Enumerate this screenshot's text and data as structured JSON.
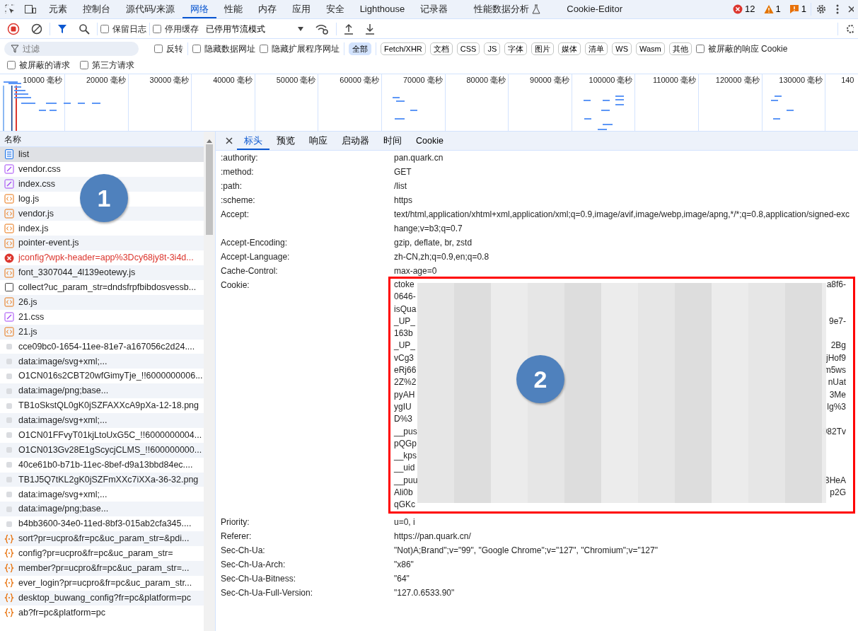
{
  "main_tabs": [
    {
      "label": "元素",
      "selected": false
    },
    {
      "label": "控制台",
      "selected": false
    },
    {
      "label": "源代码/来源",
      "selected": false
    },
    {
      "label": "网络",
      "selected": true
    },
    {
      "label": "性能",
      "selected": false
    },
    {
      "label": "内存",
      "selected": false
    },
    {
      "label": "应用",
      "selected": false
    },
    {
      "label": "安全",
      "selected": false
    },
    {
      "label": "Lighthouse",
      "selected": false
    },
    {
      "label": "记录器",
      "selected": false
    },
    {
      "label": "性能数据分析",
      "selected": false,
      "flask": true
    },
    {
      "label": "Cookie-Editor",
      "selected": false
    }
  ],
  "counts": [
    {
      "kind": "error",
      "text": "12"
    },
    {
      "kind": "warning",
      "text": "1"
    },
    {
      "kind": "issue",
      "text": "1"
    }
  ],
  "toolbar": {
    "checks": [
      {
        "label": "保留日志",
        "checked": false
      },
      {
        "label": "停用缓存",
        "checked": false
      }
    ],
    "throttle": "已停用节流模式"
  },
  "filter": {
    "placeholder": "过滤",
    "checks": [
      {
        "label": "反转",
        "checked": false
      },
      {
        "label": "隐藏数据网址",
        "checked": false
      },
      {
        "label": "隐藏扩展程序网址",
        "checked": false
      }
    ],
    "types": [
      {
        "label": "全部",
        "selected": true
      },
      {
        "label": "Fetch/XHR",
        "selected": false
      },
      {
        "label": "文档",
        "selected": false
      },
      {
        "label": "CSS",
        "selected": false
      },
      {
        "label": "JS",
        "selected": false
      },
      {
        "label": "字体",
        "selected": false
      },
      {
        "label": "图片",
        "selected": false
      },
      {
        "label": "媒体",
        "selected": false
      },
      {
        "label": "清单",
        "selected": false
      },
      {
        "label": "WS",
        "selected": false
      },
      {
        "label": "Wasm",
        "selected": false
      },
      {
        "label": "其他",
        "selected": false
      }
    ],
    "blocked_cookies": {
      "label": "被屏蔽的响应 Cookie",
      "checked": false
    },
    "row2": [
      {
        "label": "被屏蔽的请求",
        "checked": false
      },
      {
        "label": "第三方请求",
        "checked": false
      }
    ]
  },
  "timeline": {
    "ticks": [
      "10000 毫秒",
      "20000 毫秒",
      "30000 毫秒",
      "40000 毫秒",
      "50000 毫秒",
      "60000 毫秒",
      "70000 毫秒",
      "80000 毫秒",
      "90000 毫秒",
      "100000 毫秒",
      "110000 毫秒",
      "120000 毫秒",
      "130000 毫秒",
      "140"
    ]
  },
  "requests": {
    "column": "名称",
    "rows": [
      {
        "name": "list",
        "kind": "doc",
        "selected": true
      },
      {
        "name": "vendor.css",
        "kind": "css",
        "selected": false
      },
      {
        "name": "index.css",
        "kind": "css",
        "selected": false
      },
      {
        "name": "log.js",
        "kind": "js",
        "selected": false
      },
      {
        "name": "vendor.js",
        "kind": "js",
        "selected": false
      },
      {
        "name": "index.js",
        "kind": "js",
        "selected": false
      },
      {
        "name": "pointer-event.js",
        "kind": "js",
        "selected": false
      },
      {
        "name": "jconfig?wpk-header=app%3Dcy68jy8t-3i4d...",
        "kind": "error",
        "selected": false
      },
      {
        "name": "font_3307044_4l139eotewy.js",
        "kind": "js",
        "selected": false
      },
      {
        "name": "collect?uc_param_str=dndsfrpfbibdosvessb...",
        "kind": "other",
        "selected": false
      },
      {
        "name": "26.js",
        "kind": "js",
        "selected": false
      },
      {
        "name": "21.css",
        "kind": "css",
        "selected": false
      },
      {
        "name": "21.js",
        "kind": "js",
        "selected": false
      },
      {
        "name": "cce09bc0-1654-11ee-81e7-a167056c2d24....",
        "kind": "img",
        "selected": false
      },
      {
        "name": "data:image/svg+xml;...",
        "kind": "img",
        "selected": false
      },
      {
        "name": "O1CN016s2CBT20wfGimyTje_!!6000000006...",
        "kind": "img",
        "selected": false
      },
      {
        "name": "data:image/png;base...",
        "kind": "img",
        "selected": false
      },
      {
        "name": "TB1oSkstQL0gK0jSZFAXXcA9pXa-12-18.png",
        "kind": "img",
        "selected": false
      },
      {
        "name": "data:image/svg+xml;...",
        "kind": "img",
        "selected": false
      },
      {
        "name": "O1CN01FFvyT01kjLtoUxG5C_!!6000000004...",
        "kind": "img",
        "selected": false
      },
      {
        "name": "O1CN013Gv28E1gScycjCLMS_!!600000000...",
        "kind": "img",
        "selected": false
      },
      {
        "name": "40ce61b0-b71b-11ec-8bef-d9a13bbd84ec....",
        "kind": "img",
        "selected": false
      },
      {
        "name": "TB1J5Q7tKL2gK0jSZFmXXc7iXXa-36-32.png",
        "kind": "img",
        "selected": false
      },
      {
        "name": "data:image/svg+xml;...",
        "kind": "img",
        "selected": false
      },
      {
        "name": "data:image/png;base...",
        "kind": "img",
        "selected": false
      },
      {
        "name": "b4bb3600-34e0-11ed-8bf3-015ab2cfa345....",
        "kind": "img",
        "selected": false
      },
      {
        "name": "sort?pr=ucpro&fr=pc&uc_param_str=&pdi...",
        "kind": "fetch",
        "selected": false
      },
      {
        "name": "config?pr=ucpro&fr=pc&uc_param_str=",
        "kind": "fetch",
        "selected": false
      },
      {
        "name": "member?pr=ucpro&fr=pc&uc_param_str=...",
        "kind": "fetch",
        "selected": false
      },
      {
        "name": "ever_login?pr=ucpro&fr=pc&uc_param_str...",
        "kind": "fetch",
        "selected": false
      },
      {
        "name": "desktop_buwang_config?fr=pc&platform=pc",
        "kind": "fetch",
        "selected": false
      },
      {
        "name": "ab?fr=pc&platform=pc",
        "kind": "fetch",
        "selected": false
      }
    ]
  },
  "detail_tabs": [
    {
      "label": "标头",
      "selected": true
    },
    {
      "label": "预览",
      "selected": false
    },
    {
      "label": "响应",
      "selected": false
    },
    {
      "label": "启动器",
      "selected": false
    },
    {
      "label": "时间",
      "selected": false
    },
    {
      "label": "Cookie",
      "selected": false
    }
  ],
  "headers": [
    {
      "name": ":authority:",
      "value": "pan.quark.cn"
    },
    {
      "name": ":method:",
      "value": "GET"
    },
    {
      "name": ":path:",
      "value": "/list"
    },
    {
      "name": ":scheme:",
      "value": "https"
    },
    {
      "name": "Accept:",
      "value": "text/html,application/xhtml+xml,application/xml;q=0.9,image/avif,image/webp,image/apng,*/*;q=0.8,application/signed-exchange;v=b3;q=0.7"
    },
    {
      "name": "Accept-Encoding:",
      "value": "gzip, deflate, br, zstd"
    },
    {
      "name": "Accept-Language:",
      "value": "zh-CN,zh;q=0.9,en;q=0.8"
    },
    {
      "name": "Cache-Control:",
      "value": "max-age=0"
    },
    {
      "name": "Cookie:",
      "redacted_lines": [
        {
          "start": "ctoke",
          "end": "a8f6-"
        },
        {
          "start": "0646-"
        },
        {
          "start": "isQua"
        },
        {
          "start": "_UP_",
          "end": "9e7-"
        },
        {
          "start": "163b"
        },
        {
          "start": "_UP_",
          "end": "2Bg"
        },
        {
          "start": "vCg3",
          "end": "jHof9"
        },
        {
          "start": "eRj66",
          "end": "m5ws"
        },
        {
          "start": "2Z%2",
          "end": "nUat"
        },
        {
          "start": "pyAH",
          "end": "3Me"
        },
        {
          "start": "ygIU",
          "end": "lg%3"
        },
        {
          "start": "D%3"
        },
        {
          "start": "__pus",
          "end": "982Tv"
        },
        {
          "start": "pQGp"
        },
        {
          "start": "__kps"
        },
        {
          "start": "__uid"
        },
        {
          "start": "__puu",
          "end": "BHeA"
        },
        {
          "start": "Ali0b",
          "end": "p2G"
        },
        {
          "start": "qGKc"
        }
      ]
    },
    {
      "name": "Priority:",
      "value": "u=0, i"
    },
    {
      "name": "Referer:",
      "value": "https://pan.quark.cn/"
    },
    {
      "name": "Sec-Ch-Ua:",
      "value": "\"Not)A;Brand\";v=\"99\", \"Google Chrome\";v=\"127\", \"Chromium\";v=\"127\""
    },
    {
      "name": "Sec-Ch-Ua-Arch:",
      "value": "\"x86\""
    },
    {
      "name": "Sec-Ch-Ua-Bitness:",
      "value": "\"64\""
    },
    {
      "name": "Sec-Ch-Ua-Full-Version:",
      "value": "\"127.0.6533.90\""
    }
  ],
  "annotations": [
    {
      "text": "1"
    },
    {
      "text": "2"
    }
  ]
}
